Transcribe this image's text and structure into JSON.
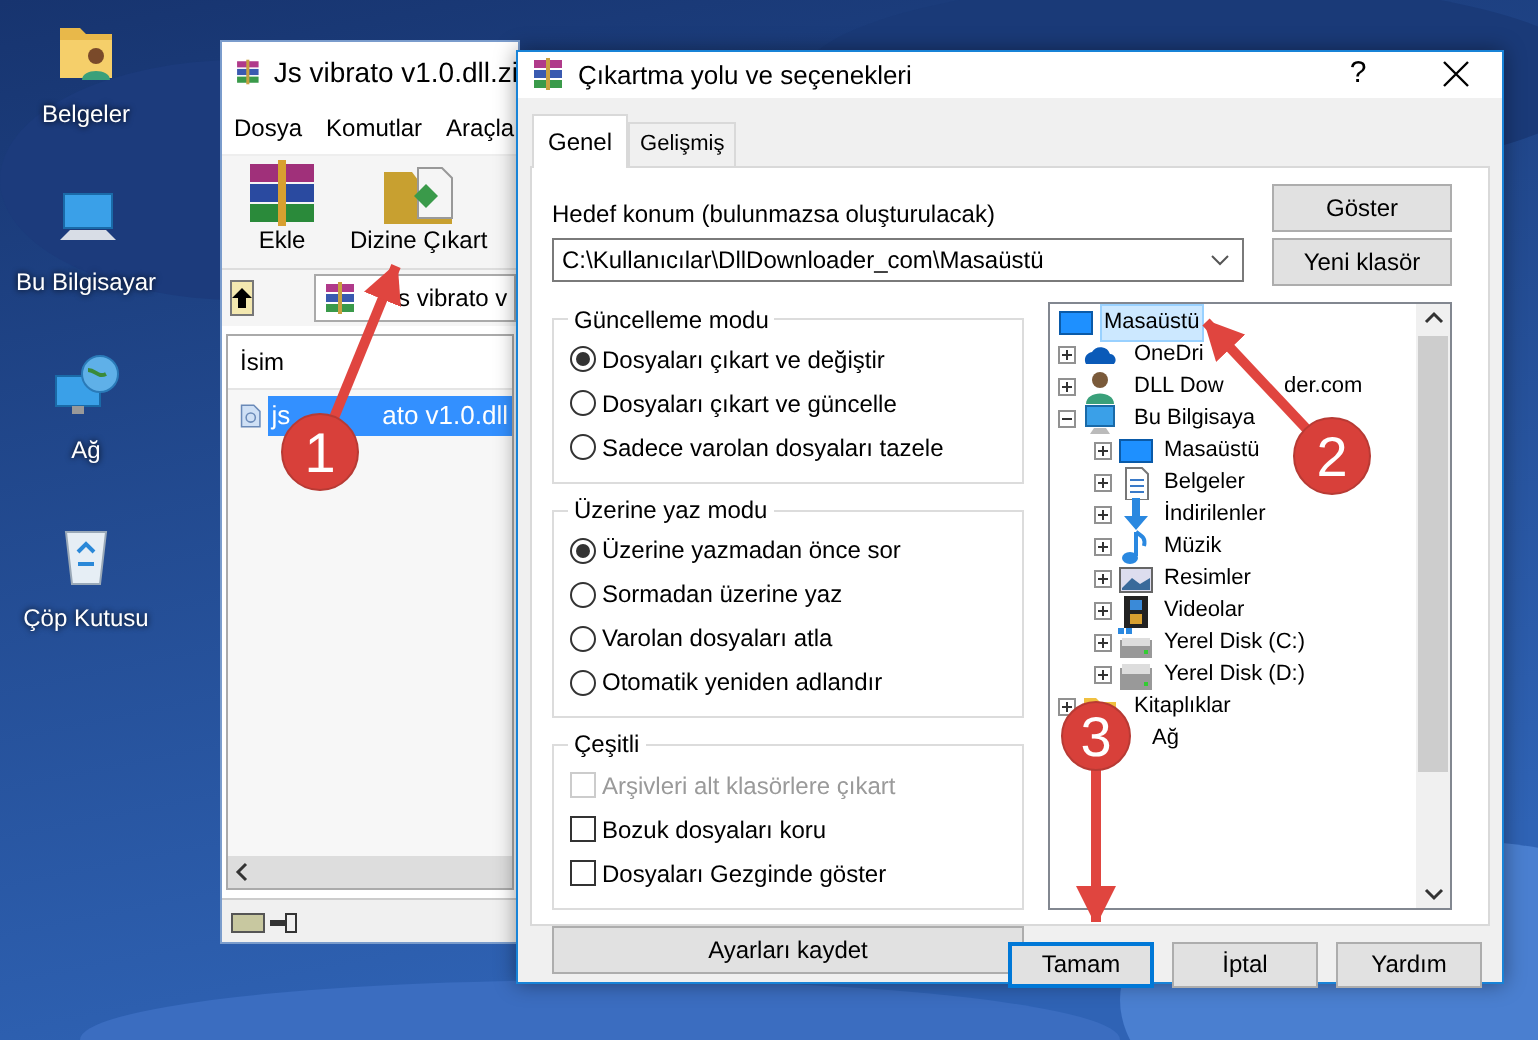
{
  "desktop_icons": [
    {
      "label": "Belgeler",
      "kind": "documents"
    },
    {
      "label": "Bu Bilgisayar",
      "kind": "computer"
    },
    {
      "label": "Ağ",
      "kind": "network"
    },
    {
      "label": "Çöp Kutusu",
      "kind": "recycle"
    }
  ],
  "archive_window": {
    "title": "Js vibrato v1.0.dll.zi",
    "menu": [
      "Dosya",
      "Komutlar",
      "Araçla"
    ],
    "toolbar": [
      {
        "label": "Ekle",
        "kind": "add"
      },
      {
        "label": "Dizine Çıkart",
        "kind": "extract"
      }
    ],
    "path": "s vibrato v",
    "column": "İsim",
    "files": [
      {
        "name_parts": [
          "js",
          "ato v1.0.dll"
        ],
        "selected": true
      }
    ]
  },
  "dialog": {
    "title": "Çıkartma yolu ve seçenekleri",
    "help": "?",
    "tabs": [
      {
        "label": "Genel",
        "selected": true
      },
      {
        "label": "Gelişmiş",
        "selected": false
      }
    ],
    "destination_label": "Hedef konum (bulunmazsa oluşturulacak)",
    "destination": "C:\\Kullanıcılar\\DllDownloader_com\\Masaüstü",
    "side_buttons": [
      "Göster",
      "Yeni klasör"
    ],
    "groups": [
      {
        "title": "Güncelleme modu",
        "options": [
          {
            "kind": "radio",
            "label": "Dosyaları çıkart ve değiştir",
            "selected": true
          },
          {
            "kind": "radio",
            "label": "Dosyaları çıkart ve güncelle",
            "selected": false
          },
          {
            "kind": "radio",
            "label": "Sadece varolan dosyaları tazele",
            "selected": false
          }
        ]
      },
      {
        "title": "Üzerine yaz modu",
        "options": [
          {
            "kind": "radio",
            "label": "Üzerine yazmadan önce sor",
            "selected": true
          },
          {
            "kind": "radio",
            "label": "Sormadan üzerine yaz",
            "selected": false
          },
          {
            "kind": "radio",
            "label": "Varolan dosyaları atla",
            "selected": false
          },
          {
            "kind": "radio",
            "label": "Otomatik yeniden adlandır",
            "selected": false
          }
        ]
      },
      {
        "title": "Çeşitli",
        "options": [
          {
            "kind": "checkbox",
            "label": "Arşivleri alt klasörlere çıkart",
            "checked": false,
            "disabled": true
          },
          {
            "kind": "checkbox",
            "label": "Bozuk dosyaları koru",
            "checked": false,
            "disabled": false
          },
          {
            "kind": "checkbox",
            "label": "Dosyaları Gezginde göster",
            "checked": false,
            "disabled": false
          }
        ]
      }
    ],
    "save_button": "Ayarları kaydet",
    "tree": [
      {
        "label": "Masaüstü",
        "kind": "desktop",
        "selected": true,
        "children": [
          {
            "label": "OneDri",
            "kind": "cloud",
            "selected": false,
            "expanded": false
          },
          {
            "label": [
              "DLL Dow",
              "der.com"
            ],
            "kind": "user",
            "selected": false,
            "expanded": false
          },
          {
            "label": "Bu Bilgisaya",
            "kind": "computer",
            "selected": false,
            "expanded": true,
            "children": [
              {
                "label": "Masaüstü",
                "kind": "desktop",
                "selected": false,
                "expanded": false
              },
              {
                "label": "Belgeler",
                "kind": "documents",
                "selected": false,
                "expanded": false
              },
              {
                "label": "İndirilenler",
                "kind": "downloads",
                "selected": false,
                "expanded": false
              },
              {
                "label": "Müzik",
                "kind": "music",
                "selected": false,
                "expanded": false
              },
              {
                "label": "Resimler",
                "kind": "pictures",
                "selected": false,
                "expanded": false
              },
              {
                "label": "Videolar",
                "kind": "videos",
                "selected": false,
                "expanded": false
              },
              {
                "label": "Yerel Disk (C:)",
                "kind": "system-disk",
                "selected": false,
                "expanded": false
              },
              {
                "label": "Yerel Disk (D:)",
                "kind": "disk",
                "selected": false,
                "expanded": false
              }
            ]
          },
          {
            "label": "Kitaplıklar",
            "kind": "library",
            "selected": false,
            "expanded": false
          },
          {
            "label": "Ağ",
            "selected": false
          }
        ]
      }
    ],
    "buttons": [
      {
        "label": "Tamam",
        "focused": true
      },
      {
        "label": "İptal",
        "focused": false
      },
      {
        "label": "Yardım",
        "focused": false
      }
    ]
  },
  "annotations": [
    {
      "label": "1"
    },
    {
      "label": "2"
    },
    {
      "label": "3"
    }
  ]
}
